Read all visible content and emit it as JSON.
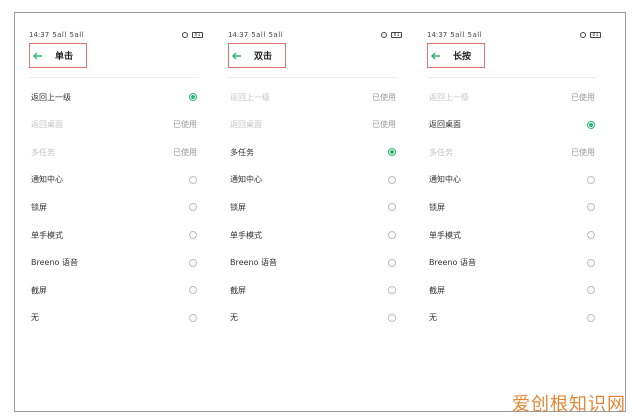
{
  "status": {
    "time": "14:37",
    "signal": "5all 5all",
    "battery": "81"
  },
  "panels": [
    {
      "title": "单击",
      "items": [
        {
          "label": "返回上一级",
          "state": "checked",
          "used_text": ""
        },
        {
          "label": "返回桌面",
          "state": "used",
          "used_text": "已使用"
        },
        {
          "label": "多任务",
          "state": "used",
          "used_text": "已使用"
        },
        {
          "label": "通知中心",
          "state": "radio",
          "used_text": ""
        },
        {
          "label": "锁屏",
          "state": "radio",
          "used_text": ""
        },
        {
          "label": "单手模式",
          "state": "radio",
          "used_text": ""
        },
        {
          "label": "Breeno 语音",
          "state": "radio",
          "used_text": ""
        },
        {
          "label": "截屏",
          "state": "radio",
          "used_text": ""
        },
        {
          "label": "无",
          "state": "radio",
          "used_text": ""
        }
      ]
    },
    {
      "title": "双击",
      "items": [
        {
          "label": "返回上一级",
          "state": "used",
          "used_text": "已使用"
        },
        {
          "label": "返回桌面",
          "state": "used",
          "used_text": "已使用"
        },
        {
          "label": "多任务",
          "state": "checked",
          "used_text": ""
        },
        {
          "label": "通知中心",
          "state": "radio",
          "used_text": ""
        },
        {
          "label": "锁屏",
          "state": "radio",
          "used_text": ""
        },
        {
          "label": "单手模式",
          "state": "radio",
          "used_text": ""
        },
        {
          "label": "Breeno 语音",
          "state": "radio",
          "used_text": ""
        },
        {
          "label": "截屏",
          "state": "radio",
          "used_text": ""
        },
        {
          "label": "无",
          "state": "radio",
          "used_text": ""
        }
      ]
    },
    {
      "title": "长按",
      "items": [
        {
          "label": "返回上一级",
          "state": "used",
          "used_text": "已使用"
        },
        {
          "label": "返回桌面",
          "state": "checked",
          "used_text": ""
        },
        {
          "label": "多任务",
          "state": "used",
          "used_text": "已使用"
        },
        {
          "label": "通知中心",
          "state": "radio",
          "used_text": ""
        },
        {
          "label": "锁屏",
          "state": "radio",
          "used_text": ""
        },
        {
          "label": "单手模式",
          "state": "radio",
          "used_text": ""
        },
        {
          "label": "Breeno 语音",
          "state": "radio",
          "used_text": ""
        },
        {
          "label": "截屏",
          "state": "radio",
          "used_text": ""
        },
        {
          "label": "无",
          "state": "radio",
          "used_text": ""
        }
      ]
    }
  ],
  "watermark": "爱创根知识网",
  "colors": {
    "accent": "#2bb673",
    "highlight_box": "#e8706a",
    "watermark": "#e07a1f"
  }
}
